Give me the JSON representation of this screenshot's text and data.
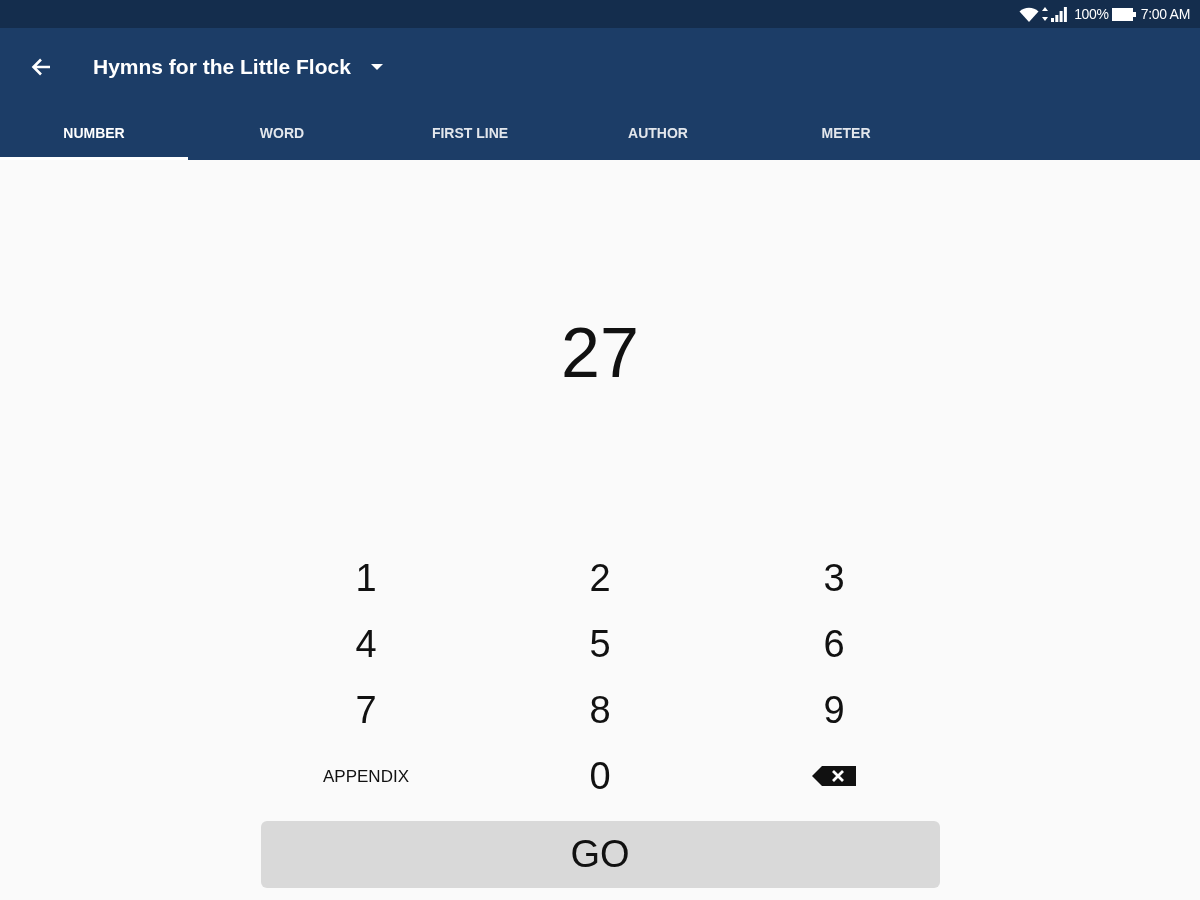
{
  "status_bar": {
    "battery": "100%",
    "time": "7:00 AM"
  },
  "app_bar": {
    "title": "Hymns for the Little Flock"
  },
  "tabs": [
    {
      "label": "NUMBER",
      "selected": true
    },
    {
      "label": "WORD",
      "selected": false
    },
    {
      "label": "FIRST LINE",
      "selected": false
    },
    {
      "label": "AUTHOR",
      "selected": false
    },
    {
      "label": "METER",
      "selected": false
    }
  ],
  "entry": {
    "value": "27"
  },
  "keypad": [
    {
      "kind": "digit",
      "label": "1"
    },
    {
      "kind": "digit",
      "label": "2"
    },
    {
      "kind": "digit",
      "label": "3"
    },
    {
      "kind": "digit",
      "label": "4"
    },
    {
      "kind": "digit",
      "label": "5"
    },
    {
      "kind": "digit",
      "label": "6"
    },
    {
      "kind": "digit",
      "label": "7"
    },
    {
      "kind": "digit",
      "label": "8"
    },
    {
      "kind": "digit",
      "label": "9"
    },
    {
      "kind": "text",
      "label": "APPENDIX"
    },
    {
      "kind": "digit",
      "label": "0"
    },
    {
      "kind": "backspace"
    }
  ],
  "go_button": {
    "label": "GO"
  }
}
